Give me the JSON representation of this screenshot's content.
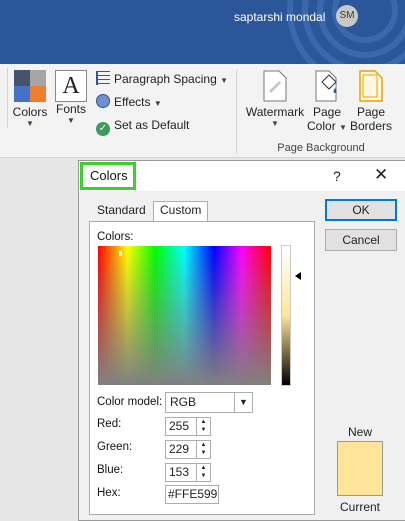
{
  "user": {
    "name": "saptarshi mondal",
    "initials": "SM"
  },
  "ribbon": {
    "colors_label": "Colors",
    "fonts_label": "Fonts",
    "fonts_glyph": "A",
    "paragraph_spacing": "Paragraph Spacing",
    "effects": "Effects",
    "set_as_default": "Set as Default",
    "watermark": "Watermark",
    "page_color_line1": "Page",
    "page_color_line2": "Color",
    "page_borders_line1": "Page",
    "page_borders_line2": "Borders",
    "group_label": "Page Background"
  },
  "dialog": {
    "title": "Colors",
    "help": "?",
    "close": "✕",
    "tabs": [
      {
        "label": "Standard",
        "active": false
      },
      {
        "label": "Custom",
        "active": true
      }
    ],
    "colors_label": "Colors:",
    "color_model_label": "Color model:",
    "color_model_value": "RGB",
    "red_label": "Red:",
    "red_value": "255",
    "green_label": "Green:",
    "green_value": "229",
    "blue_label": "Blue:",
    "blue_value": "153",
    "hex_label": "Hex:",
    "hex_value": "#FFE599",
    "ok_label": "OK",
    "cancel_label": "Cancel",
    "new_label": "New",
    "current_label": "Current",
    "selected_color": "#FFE599"
  },
  "colors": {
    "titlebar": "#2b579a",
    "highlight_box": "#3ccf2e",
    "ok_border": "#0078d7"
  }
}
